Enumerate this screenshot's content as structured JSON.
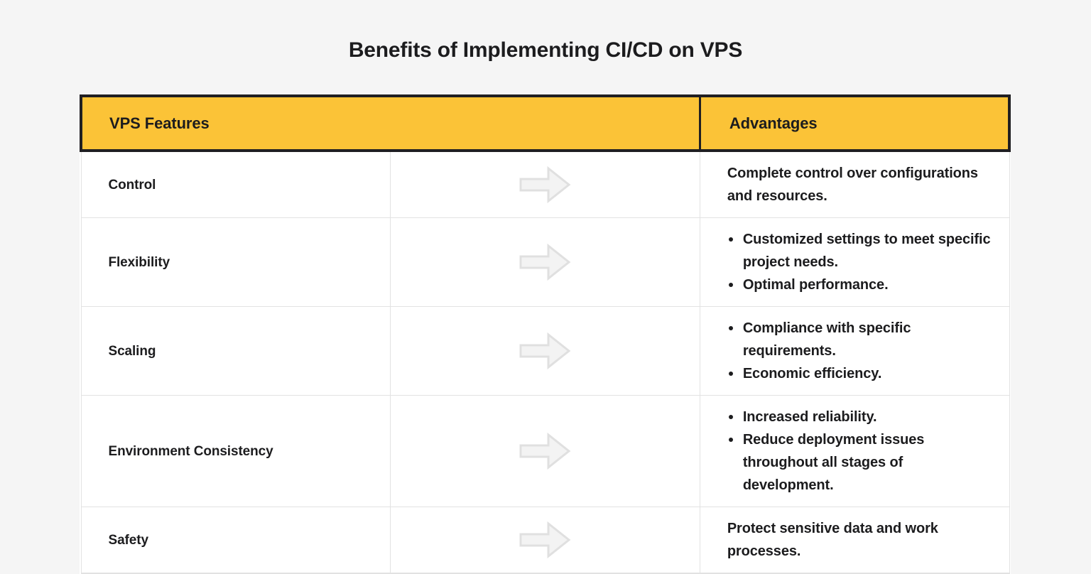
{
  "page": {
    "background_color": "#f5f5f5",
    "title": "Benefits of Implementing CI/CD on VPS"
  },
  "table": {
    "accent_color": "#fbc337",
    "header_border_color": "#201f22",
    "row_border_color": "#e2e2e2",
    "text_color": "#1c1c1e",
    "arrow_icon_color": "#e0e0e0",
    "columns": {
      "features_header": "VPS Features",
      "arrow_header": "",
      "advantages_header": "Advantages"
    },
    "rows": [
      {
        "feature": "Control",
        "arrow": "arrow-right-icon",
        "advantages_type": "text",
        "advantages_text": "Complete control over configurations and resources.",
        "advantages": []
      },
      {
        "feature": "Flexibility",
        "arrow": "arrow-right-icon",
        "advantages_type": "list",
        "advantages_text": "",
        "advantages": [
          "Customized settings to meet specific project needs.",
          "Optimal performance."
        ]
      },
      {
        "feature": "Scaling",
        "arrow": "arrow-right-icon",
        "advantages_type": "list",
        "advantages_text": "",
        "advantages": [
          "Compliance with specific requirements.",
          "Economic efficiency."
        ]
      },
      {
        "feature": "Environment Consistency",
        "arrow": "arrow-right-icon",
        "advantages_type": "list",
        "advantages_text": "",
        "advantages": [
          "Increased reliability.",
          "Reduce deployment issues throughout all stages of development."
        ]
      },
      {
        "feature": "Safety",
        "arrow": "arrow-right-icon",
        "advantages_type": "text",
        "advantages_text": "Protect sensitive data and work processes.",
        "advantages": []
      }
    ]
  }
}
